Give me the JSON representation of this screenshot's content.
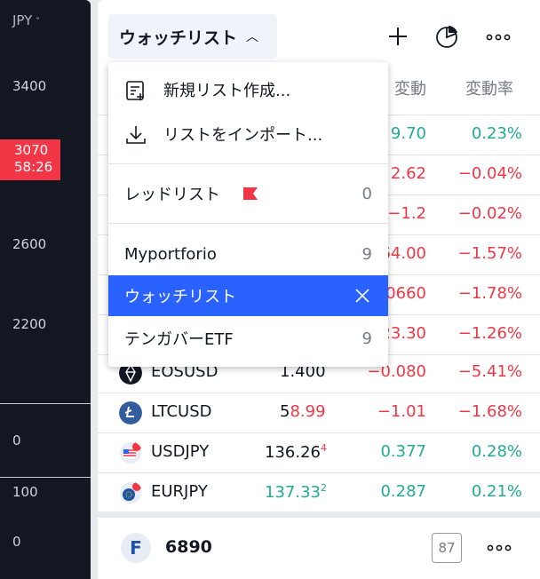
{
  "scale": {
    "currency": "JPY",
    "ticks": [
      "3400",
      "2600",
      "2200",
      "0",
      "100",
      "0"
    ],
    "price_badge": {
      "price": "3070",
      "countdown": "58:26"
    }
  },
  "watchlist": {
    "title": "ウォッチリスト",
    "columns": {
      "change": "変動",
      "change_pct": "変動率"
    },
    "rows": [
      {
        "symbol": "",
        "last": "",
        "change": "9.70",
        "change_pct": "0.23%",
        "dir": "pos"
      },
      {
        "symbol": "",
        "last": "",
        "change": "2.62",
        "change_pct": "−0.04%",
        "dir": "neg"
      },
      {
        "symbol": "",
        "last": "",
        "change": "−1.2",
        "change_pct": "−0.02%",
        "dir": "neg"
      },
      {
        "symbol": "",
        "last": "",
        "change": "64.00",
        "change_pct": "−1.57%",
        "dir": "neg"
      },
      {
        "symbol": "",
        "last": "",
        "change": "0660",
        "change_pct": "−1.78%",
        "dir": "neg"
      },
      {
        "symbol": "",
        "last": "",
        "change": "23.30",
        "change_pct": "−1.26%",
        "dir": "neg"
      },
      {
        "symbol": "EOSUSD",
        "last": "1.400",
        "change": "−0.080",
        "change_pct": "−5.41%",
        "dir": "neg",
        "icon_color": "#131722"
      },
      {
        "symbol": "LTCUSD",
        "last_main": "5",
        "last_hl": "8.99",
        "change": "−1.01",
        "change_pct": "−1.68%",
        "dir": "neg",
        "icon_color": "#345d9d"
      },
      {
        "symbol": "USDJPY",
        "last_main": "136.26",
        "last_sup": "4",
        "change": "0.377",
        "change_pct": "0.28%",
        "dir": "pos",
        "icon_color": "#e8ecf5"
      },
      {
        "symbol": "EURJPY",
        "last_main": "137.33",
        "last_sup": "2",
        "change": "0.287",
        "change_pct": "0.21%",
        "dir": "pos",
        "icon_color": "#e8ecf5"
      }
    ]
  },
  "menu": {
    "create_new": "新規リスト作成...",
    "import": "リストをインポート...",
    "red_list": {
      "label": "レッドリスト",
      "count": "0",
      "flag_color": "#f23645"
    },
    "lists": [
      {
        "label": "Myportforio",
        "count": "9"
      },
      {
        "label": "ウォッチリスト",
        "count": "",
        "active": true
      },
      {
        "label": "テンガバーETF",
        "count": "9"
      }
    ]
  },
  "detail": {
    "logo_letter": "F",
    "symbol": "6890",
    "badge": "87"
  },
  "colors": {
    "positive": "#22ab94",
    "negative": "#f23645",
    "accent": "#2962ff"
  }
}
